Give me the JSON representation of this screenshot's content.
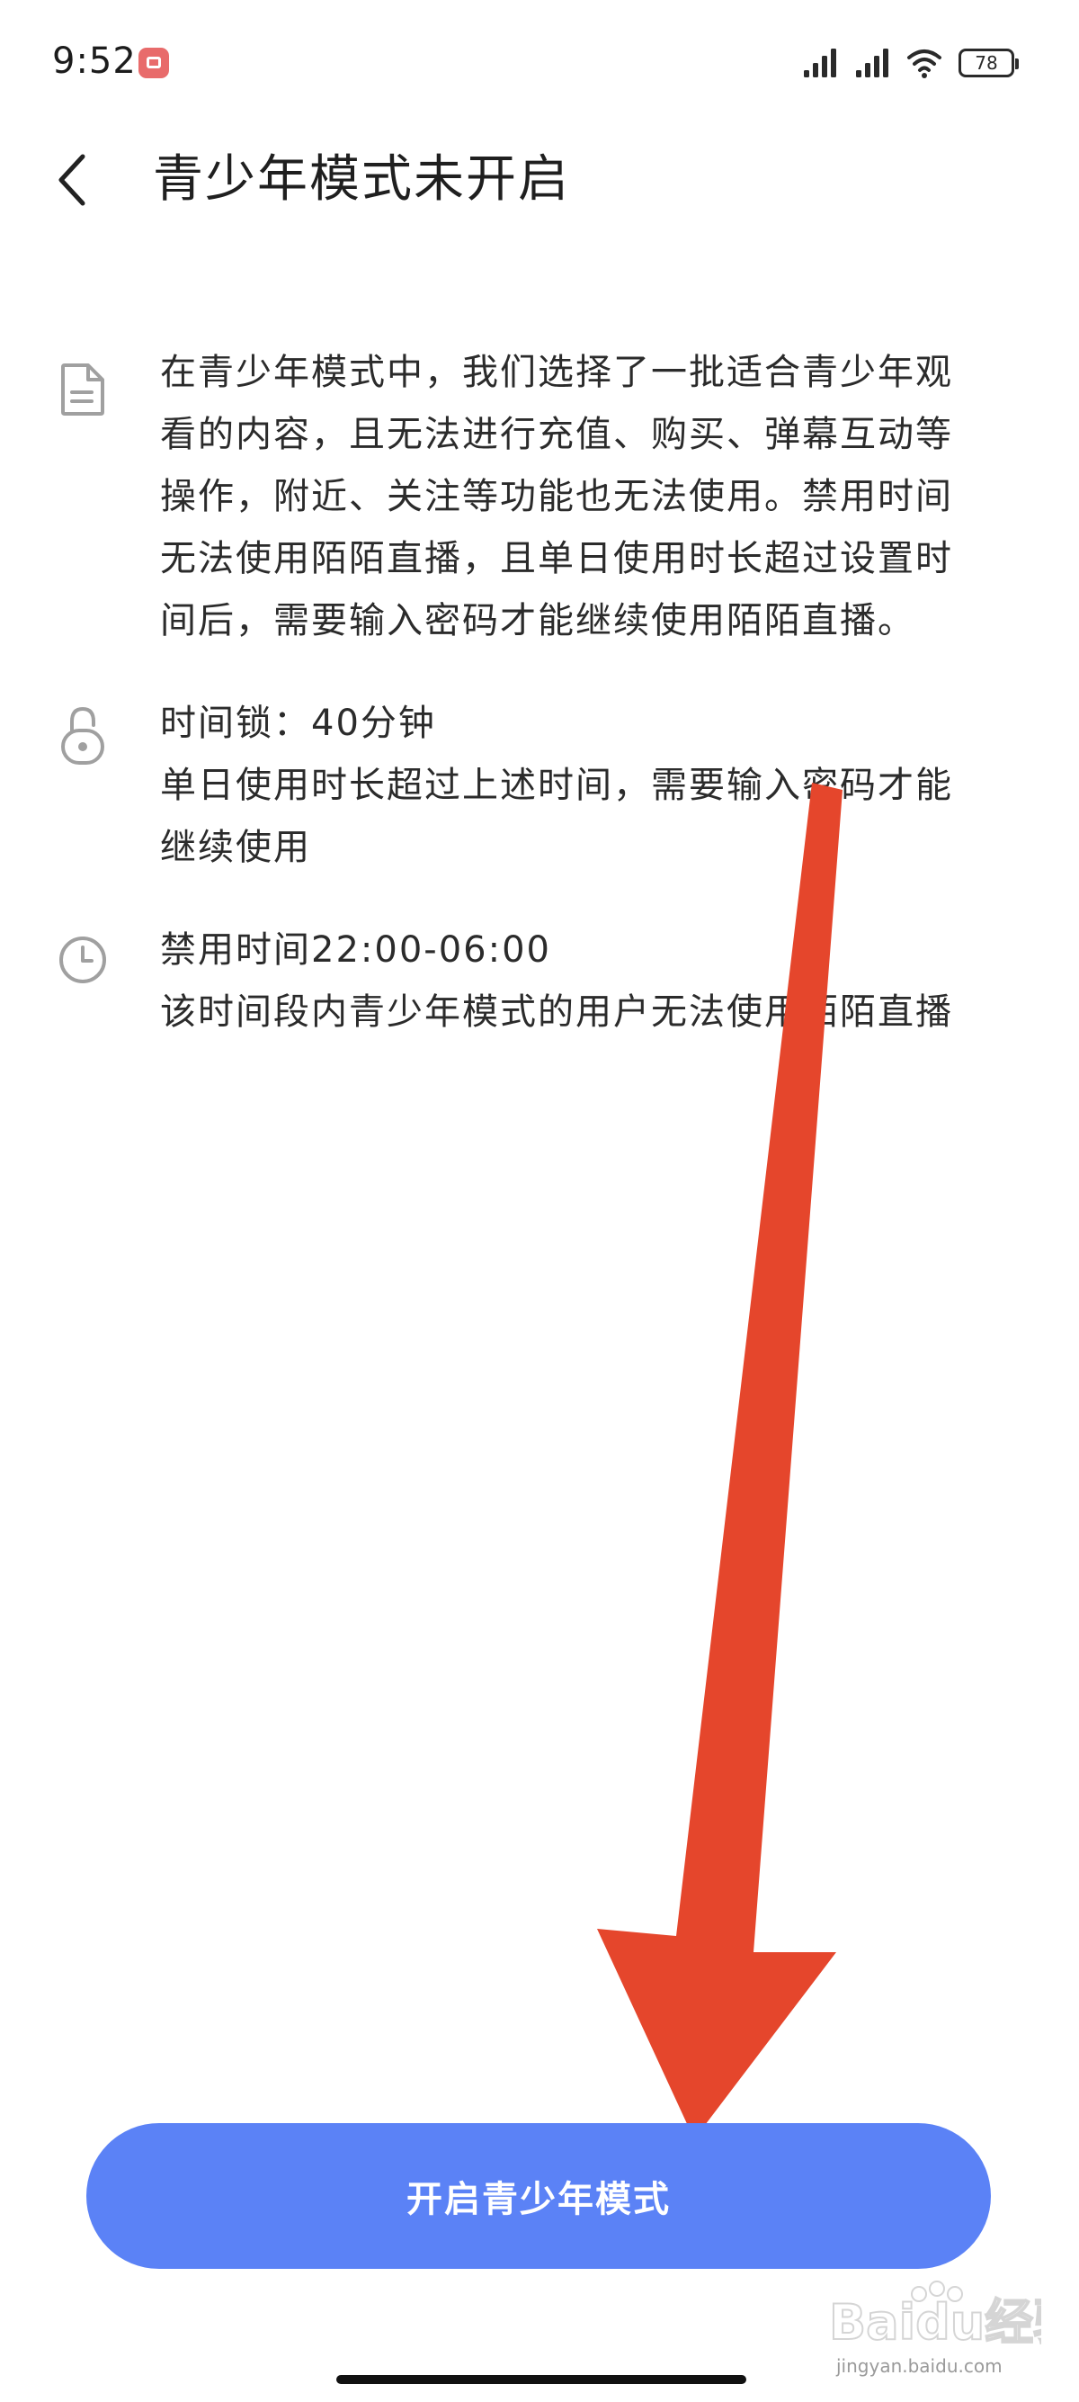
{
  "status_bar": {
    "time": "9:52",
    "battery": "78",
    "icons": [
      "notification-app-icon",
      "signal-icon",
      "signal-icon",
      "wifi-icon",
      "battery-icon"
    ]
  },
  "header": {
    "title": "青少年模式未开启",
    "back_icon": "chevron-left-icon"
  },
  "info_items": [
    {
      "icon": "document-icon",
      "lines": [
        "在青少年模式中，我们选择了一批适合青少年观",
        "看的内容，且无法进行充值、购买、弹幕互动等",
        "操作，附近、关注等功能也无法使用。禁用时间",
        "无法使用陌陌直播，且单日使用时长超过设置时",
        "间后，需要输入密码才能继续使用陌陌直播。"
      ]
    },
    {
      "icon": "lock-icon",
      "lines": [
        "时间锁：40分钟",
        "单日使用时长超过上述时间，需要输入密码才能",
        "继续使用"
      ]
    },
    {
      "icon": "clock-icon",
      "lines": [
        "禁用时间22:00-06:00",
        "该时间段内青少年模式的用户无法使用陌陌直播"
      ]
    }
  ],
  "primary_action": {
    "label": "开启青少年模式"
  },
  "watermark": {
    "text": "Baidu经验",
    "sub": "jingyan.baidu.com"
  },
  "colors": {
    "primary": "#5b82f6",
    "annotation_arrow": "#e5462c",
    "icon_gray": "#9e9e9e"
  }
}
